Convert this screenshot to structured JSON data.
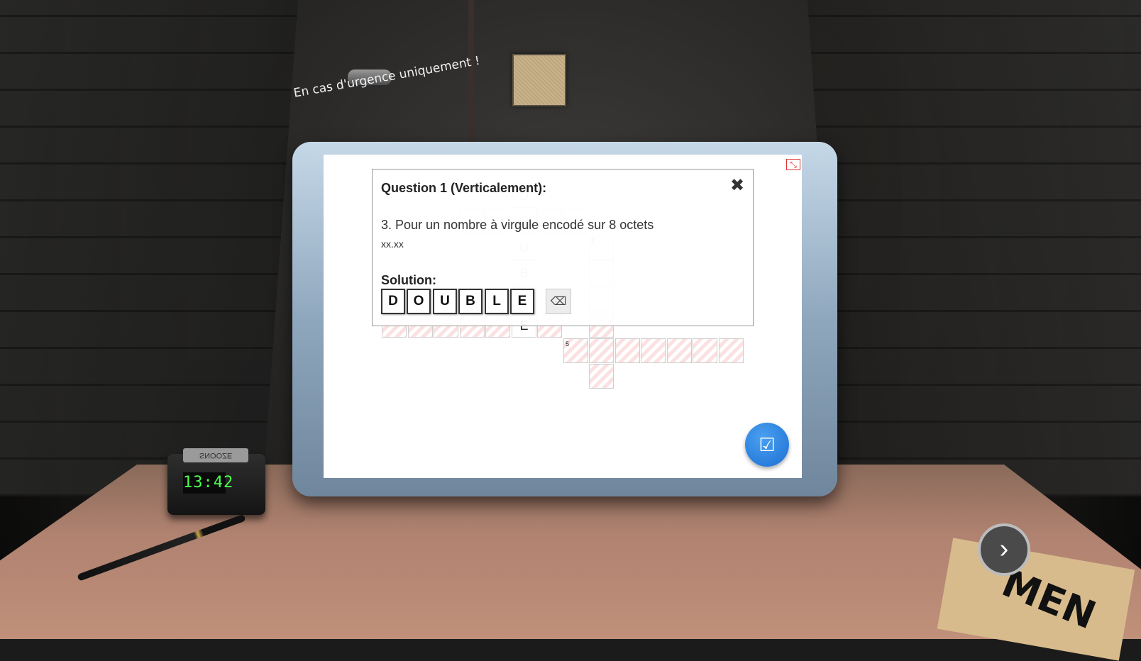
{
  "scene": {
    "emergency_sign": "En cas d'urgence uniquement !",
    "clock_time": "13:42",
    "clock_snooze_label": "SNOOZE",
    "paper_text": "MEN"
  },
  "crossword": {
    "hint_numbers": {
      "n2": "2",
      "n5": "5"
    },
    "vertical_letters": [
      "D",
      "O",
      "U",
      "B",
      "L",
      "E"
    ]
  },
  "dialog": {
    "title": "Question 1 (Verticalement):",
    "close_icon": "✖",
    "question": "3. Pour un nombre à virgule encodé sur 8 octets",
    "format_hint": "xx.xx",
    "solution_label": "Solution:",
    "solution_letters": [
      "D",
      "O",
      "U",
      "B",
      "L",
      "E"
    ],
    "clear_icon": "⌫"
  },
  "controls": {
    "validate_icon": "☑",
    "next_icon": "›",
    "fullscreen_icon": "⤡"
  },
  "colors": {
    "validate": "#1c6fd4",
    "clock_digits": "#4cff4c",
    "cell_stripe": "#fbe1e1"
  }
}
